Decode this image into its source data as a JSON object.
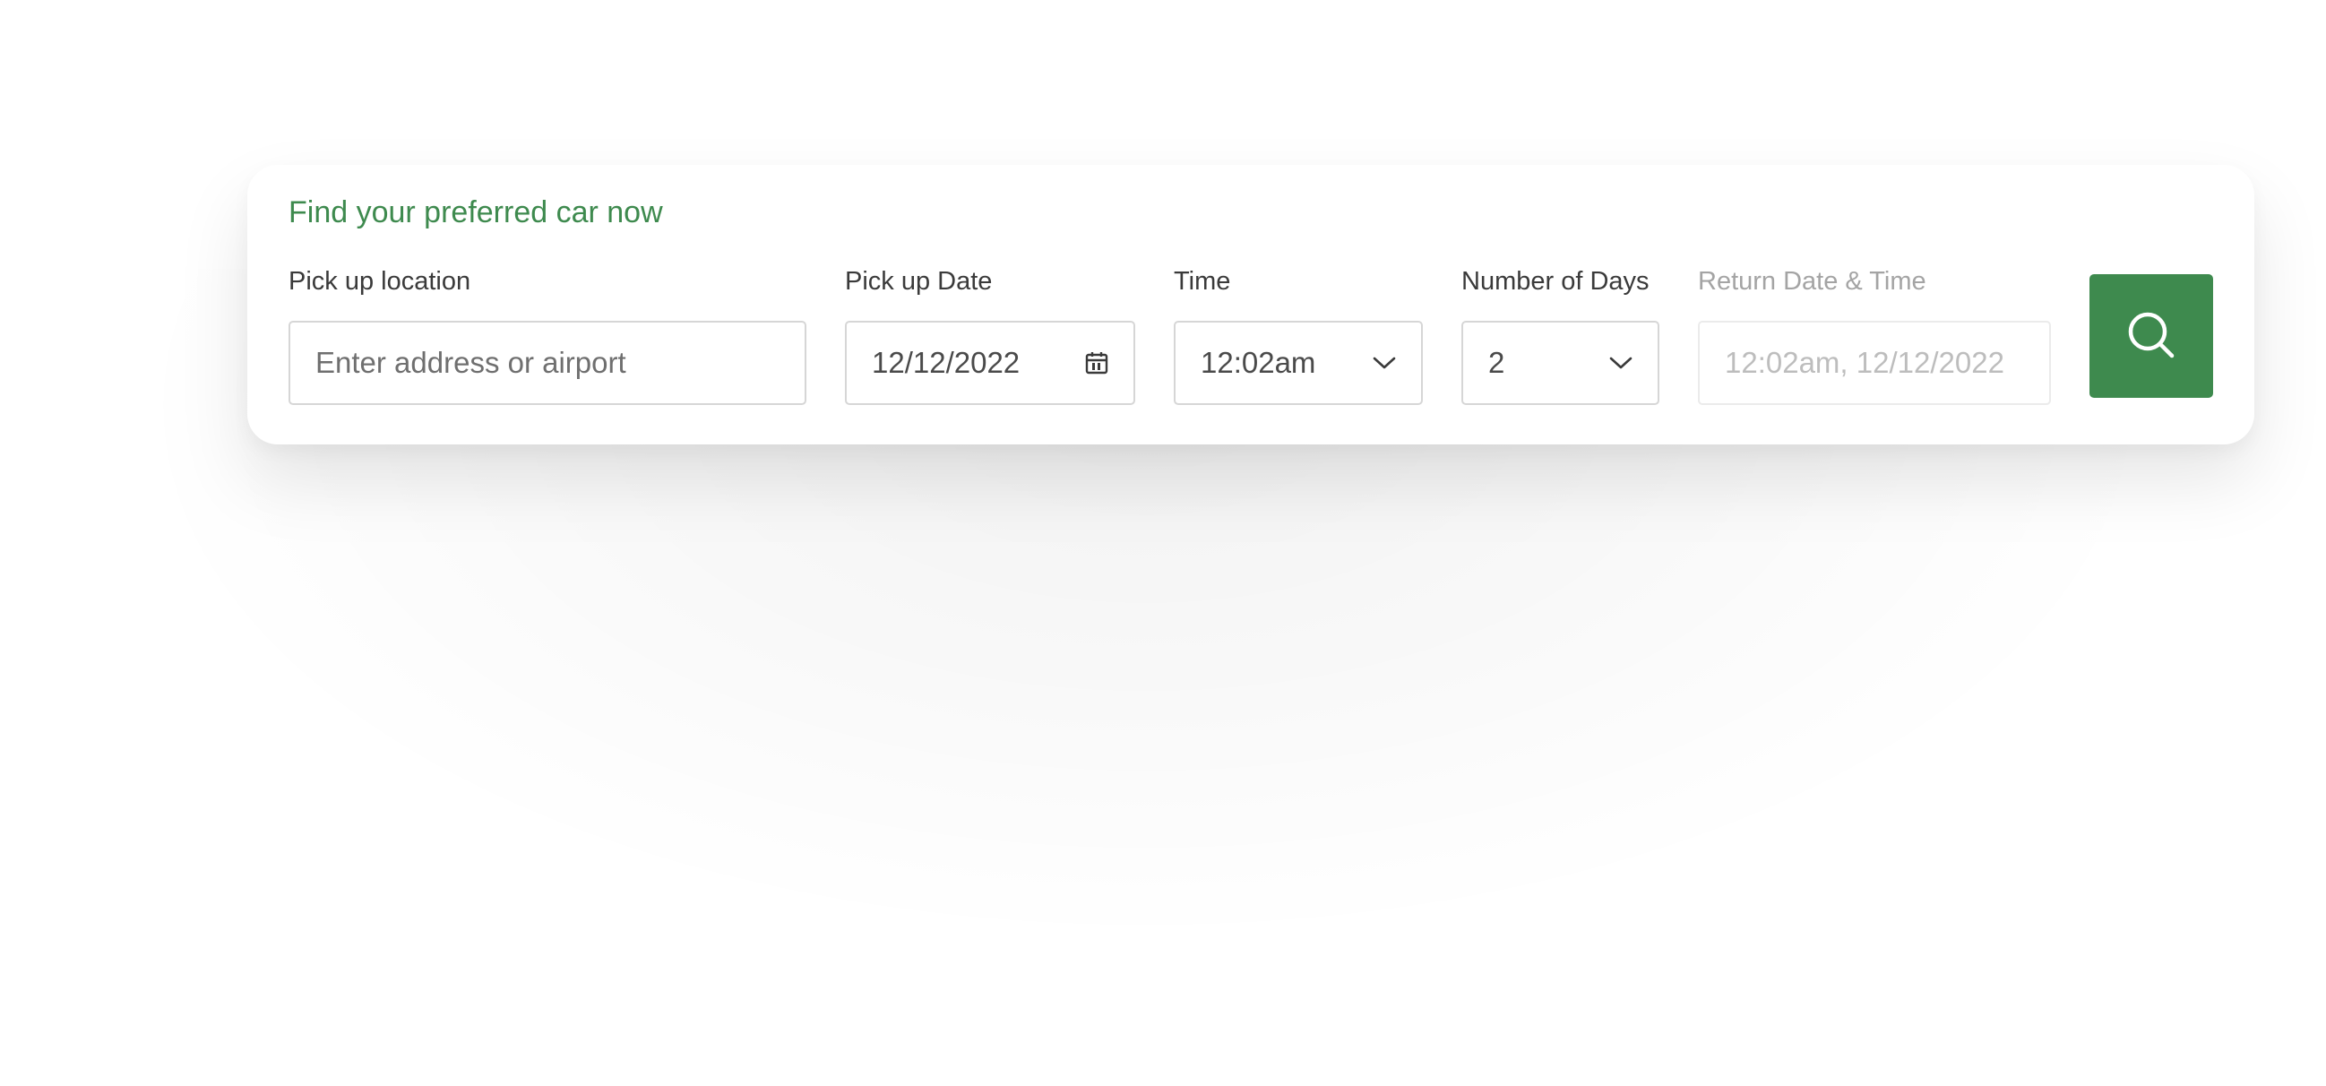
{
  "search": {
    "headline": "Find your preferred car now",
    "pickup_location": {
      "label": "Pick up location",
      "placeholder": "Enter address or airport",
      "value": ""
    },
    "pickup_date": {
      "label": "Pick up Date",
      "value": "12/12/2022",
      "icon": "calendar-icon"
    },
    "time": {
      "label": "Time",
      "value": "12:02am",
      "icon": "chevron-down-icon"
    },
    "days": {
      "label": "Number of Days",
      "value": "2",
      "icon": "chevron-down-icon"
    },
    "return": {
      "label": "Return Date & Time",
      "value": "12:02am, 12/12/2022"
    },
    "button": {
      "icon": "search-icon"
    }
  },
  "colors": {
    "accent": "#3e8a4e",
    "label": "#3a3a3a",
    "muted": "#a4a4a4",
    "border": "#d6d6d6"
  }
}
